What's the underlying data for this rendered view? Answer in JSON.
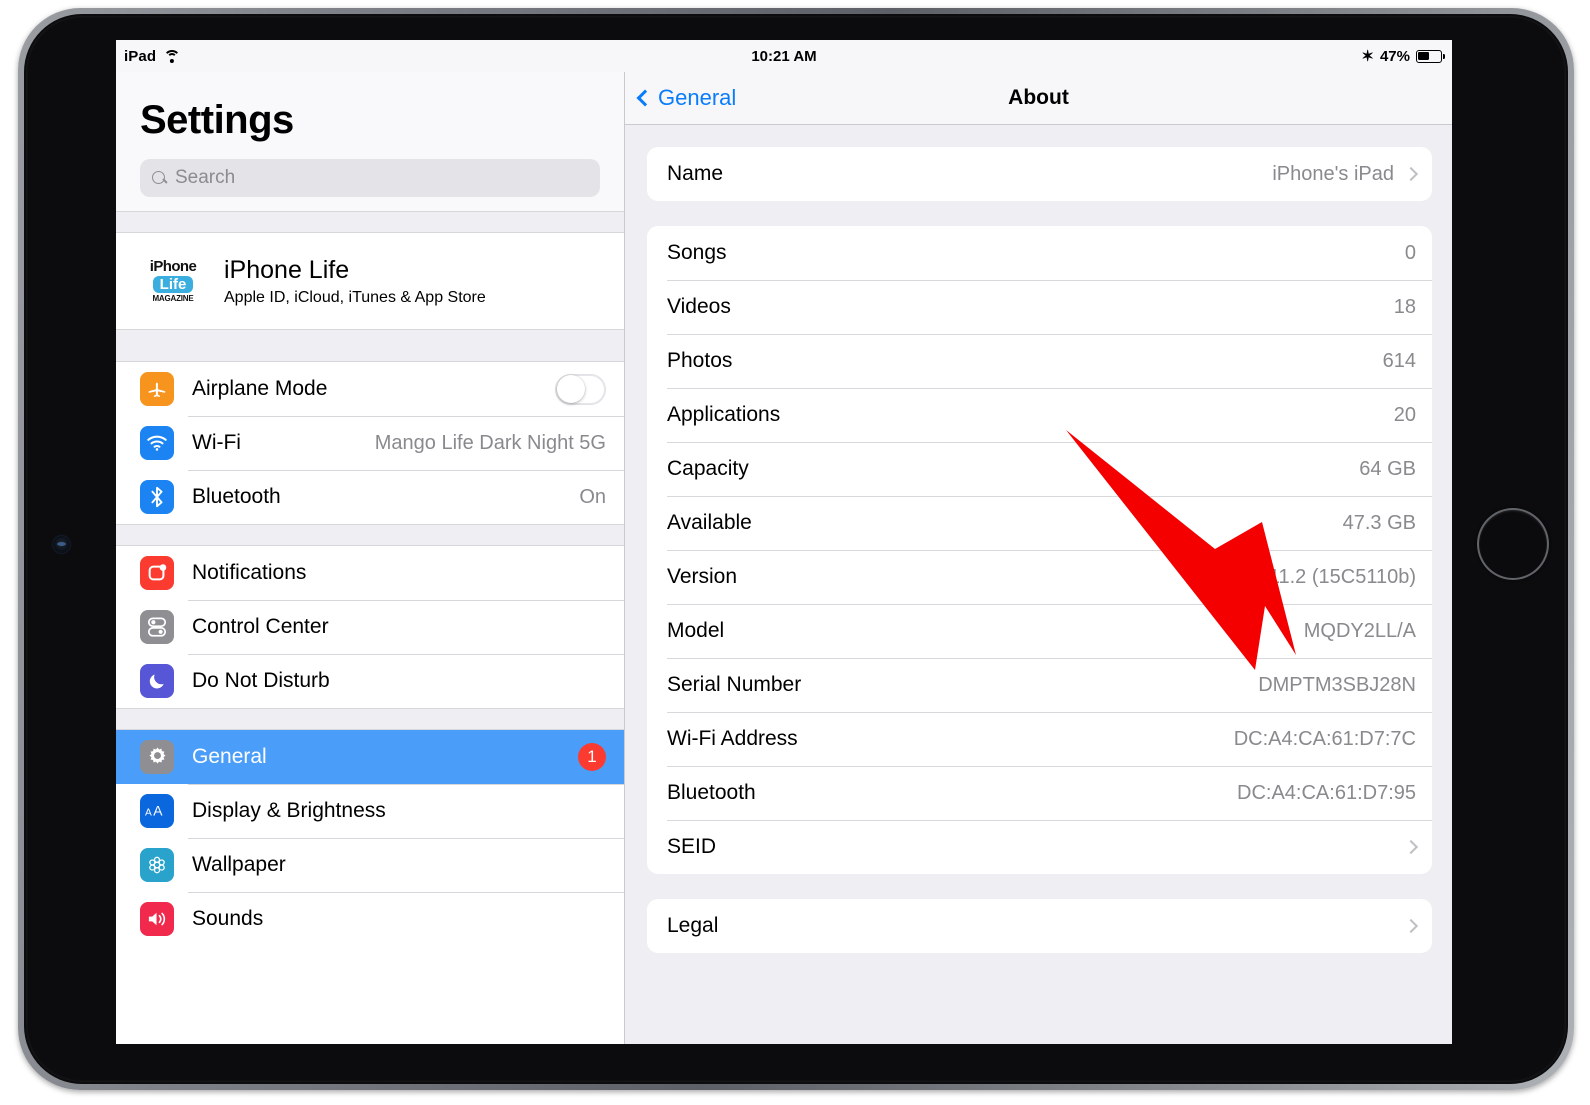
{
  "status_bar": {
    "device_label": "iPad",
    "wifi_icon": "wifi-icon",
    "time": "10:21 AM",
    "bluetooth_icon": "bluetooth-icon",
    "battery_percent": "47%",
    "battery_level": 47
  },
  "sidebar": {
    "title": "Settings",
    "search": {
      "placeholder": "Search",
      "value": "",
      "icon": "search-icon"
    },
    "account": {
      "name": "iPhone Life",
      "subtitle": "Apple ID, iCloud, iTunes & App Store",
      "logo_line1": "iPhone",
      "logo_line2": "Life",
      "logo_line3": "MAGAZINE"
    },
    "groups": [
      {
        "items": [
          {
            "label": "Airplane Mode",
            "value": "",
            "icon": "airplane-icon",
            "icon_color": "#f7941d",
            "control": "toggle",
            "toggle_on": false
          },
          {
            "label": "Wi-Fi",
            "value": "Mango Life Dark Night 5G",
            "icon": "wifi-icon",
            "icon_color": "#1b84f2",
            "control": "value"
          },
          {
            "label": "Bluetooth",
            "value": "On",
            "icon": "bluetooth-icon",
            "icon_color": "#1b84f2",
            "control": "value"
          }
        ]
      },
      {
        "items": [
          {
            "label": "Notifications",
            "value": "",
            "icon": "notifications-icon",
            "icon_color": "#fc3b30",
            "control": "none"
          },
          {
            "label": "Control Center",
            "value": "",
            "icon": "control-center-icon",
            "icon_color": "#8e8e93",
            "control": "none"
          },
          {
            "label": "Do Not Disturb",
            "value": "",
            "icon": "moon-icon",
            "icon_color": "#5656d6",
            "control": "none"
          }
        ]
      },
      {
        "items": [
          {
            "label": "General",
            "value": "",
            "icon": "gear-icon",
            "icon_color": "#8e8e93",
            "control": "badge",
            "badge": "1",
            "selected": true
          },
          {
            "label": "Display & Brightness",
            "value": "",
            "icon": "text-size-icon",
            "icon_color": "#0a67de",
            "control": "none"
          },
          {
            "label": "Wallpaper",
            "value": "",
            "icon": "wallpaper-icon",
            "icon_color": "#2aa3cc",
            "control": "none"
          },
          {
            "label": "Sounds",
            "value": "",
            "icon": "speaker-icon",
            "icon_color": "#f1294c",
            "control": "none"
          }
        ]
      }
    ]
  },
  "detail": {
    "back_label": "General",
    "title": "About",
    "sections": [
      {
        "rows": [
          {
            "label": "Name",
            "value": "iPhone's iPad",
            "disclosure": true
          }
        ]
      },
      {
        "rows": [
          {
            "label": "Songs",
            "value": "0",
            "disclosure": false
          },
          {
            "label": "Videos",
            "value": "18",
            "disclosure": false
          },
          {
            "label": "Photos",
            "value": "614",
            "disclosure": false
          },
          {
            "label": "Applications",
            "value": "20",
            "disclosure": false
          },
          {
            "label": "Capacity",
            "value": "64 GB",
            "disclosure": false
          },
          {
            "label": "Available",
            "value": "47.3 GB",
            "disclosure": false
          },
          {
            "label": "Version",
            "value": "11.2 (15C5110b)",
            "disclosure": false
          },
          {
            "label": "Model",
            "value": "MQDY2LL/A",
            "disclosure": false
          },
          {
            "label": "Serial Number",
            "value": "DMPTM3SBJ28N",
            "disclosure": false
          },
          {
            "label": "Wi-Fi Address",
            "value": "DC:A4:CA:61:D7:7C",
            "disclosure": false
          },
          {
            "label": "Bluetooth",
            "value": "DC:A4:CA:61:D7:95",
            "disclosure": false
          },
          {
            "label": "SEID",
            "value": "",
            "disclosure": true
          }
        ]
      },
      {
        "rows": [
          {
            "label": "Legal",
            "value": "",
            "disclosure": true
          }
        ]
      }
    ]
  },
  "annotation": {
    "type": "arrow",
    "color": "#f40000",
    "points_to": "Model"
  },
  "hardware": {
    "camera": "front-camera",
    "home_button": "home-button"
  }
}
